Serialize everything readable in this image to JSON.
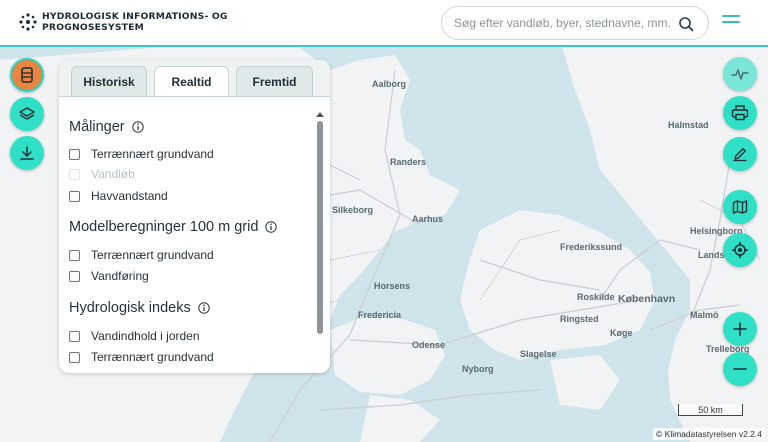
{
  "header": {
    "title_line1": "HYDROLOGISK INFORMATIONS- OG",
    "title_line2": "PROGNOSESYSTEM",
    "search_placeholder": "Søg efter vandløb, byer, stednavne, mm.",
    "search_icon": "search-icon",
    "menu_icon": "hamburger-menu-icon"
  },
  "left_toolbar": [
    {
      "icon": "data-layers-icon"
    },
    {
      "icon": "layers-icon"
    },
    {
      "icon": "download-icon"
    }
  ],
  "tabs": [
    {
      "label": "Historisk"
    },
    {
      "label": "Realtid"
    },
    {
      "label": "Fremtid"
    }
  ],
  "active_tab": "Realtid",
  "sections": [
    {
      "title": "Målinger",
      "items": [
        "Terrænnært grundvand",
        "Vandløb",
        "Havvandstand"
      ]
    },
    {
      "title": "Modelberegninger 100 m grid",
      "items": [
        "Terrænnært grundvand",
        "Vandføring"
      ]
    },
    {
      "title": "Hydrologisk indeks",
      "items": [
        "Vandindhold i jorden",
        "Terrænnært grundvand"
      ]
    }
  ],
  "right_toolbar": [
    {
      "icon": "activity-icon"
    },
    {
      "icon": "print-icon"
    },
    {
      "icon": "edit-icon"
    },
    {
      "icon": "map-icon"
    },
    {
      "icon": "locate-icon"
    },
    {
      "icon": "zoom-in-icon"
    },
    {
      "icon": "zoom-out-icon"
    }
  ],
  "map": {
    "labels": [
      "Aalborg",
      "Randers",
      "Silkeborg",
      "Aarhus",
      "Horsens",
      "Fredericia",
      "Odense",
      "Slagelse",
      "Roskilde",
      "København",
      "Malmö",
      "Helsingborg",
      "Landskrona",
      "Halmstad",
      "Frederikssund",
      "Trelleborg",
      "Køge",
      "Ringsted",
      "Nyborg"
    ]
  },
  "scale_label": "50 km",
  "attribution": "© Klimadatastyrelsen v2.2.4",
  "colors": {
    "accent": "#2fe0c6",
    "orange": "#e8853f",
    "header_line": "#39c9c1"
  }
}
